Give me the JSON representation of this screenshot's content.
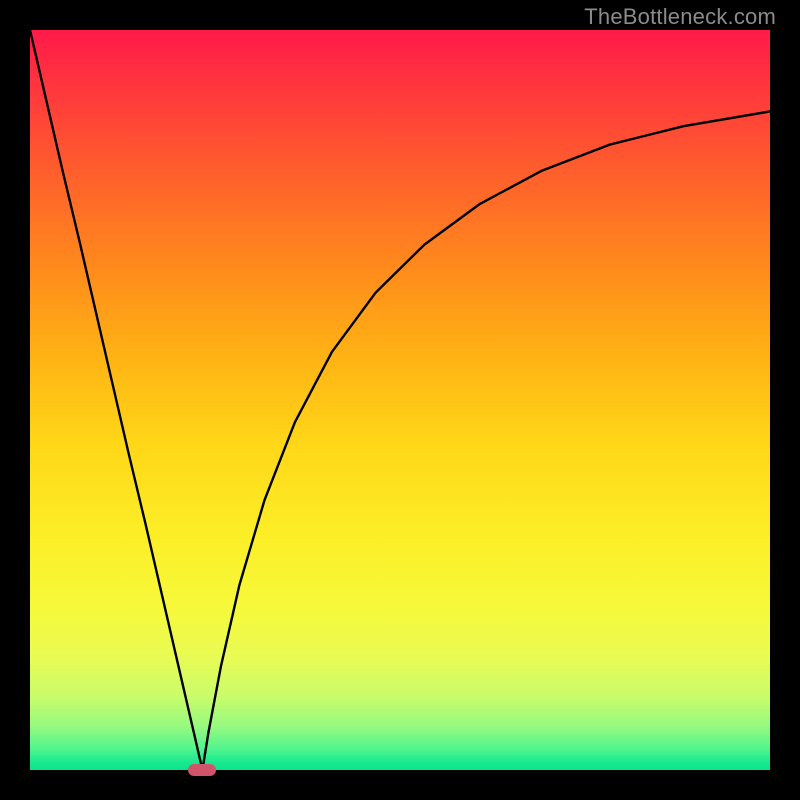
{
  "watermark": "TheBottleneck.com",
  "chart_data": {
    "type": "line",
    "title": "",
    "xlabel": "",
    "ylabel": "",
    "xlim": [
      0,
      100
    ],
    "ylim": [
      0,
      100
    ],
    "grid": false,
    "legend": false,
    "background_gradient": {
      "top": "#ff1a4a",
      "bottom": "#0be28d",
      "meaning": "red=high bottleneck, green=low bottleneck"
    },
    "series": [
      {
        "name": "left-branch",
        "x": [
          0.0,
          2.2,
          4.4,
          6.7,
          8.9,
          11.1,
          13.3,
          15.6,
          17.8,
          20.0,
          22.2,
          23.3
        ],
        "values": [
          100.0,
          90.5,
          81.0,
          71.4,
          61.9,
          52.4,
          42.9,
          33.3,
          23.8,
          14.3,
          4.8,
          0.0
        ]
      },
      {
        "name": "right-branch",
        "x": [
          23.3,
          24.1,
          25.8,
          28.3,
          31.7,
          35.8,
          40.8,
          46.7,
          53.3,
          60.8,
          69.2,
          78.3,
          88.3,
          100.0
        ],
        "values": [
          0.0,
          5.0,
          14.0,
          25.0,
          36.5,
          47.0,
          56.5,
          64.5,
          71.0,
          76.5,
          81.0,
          84.5,
          87.0,
          89.0
        ]
      }
    ],
    "marker": {
      "x": 23.3,
      "y": 0.0,
      "color": "#d1556a",
      "shape": "pill"
    }
  }
}
